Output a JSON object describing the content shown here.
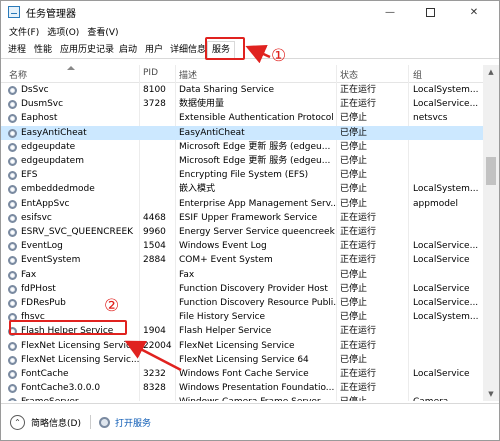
{
  "window": {
    "title": "任务管理器"
  },
  "window_controls": {
    "minimize": "—",
    "close": "✕"
  },
  "menu": [
    "文件(F)",
    "选项(O)",
    "查看(V)"
  ],
  "tabs": [
    {
      "label": "进程",
      "active": false
    },
    {
      "label": "性能",
      "active": false
    },
    {
      "label": "应用历史记录",
      "active": false
    },
    {
      "label": "启动",
      "active": false
    },
    {
      "label": "用户",
      "active": false
    },
    {
      "label": "详细信息",
      "active": false
    },
    {
      "label": "服务",
      "active": true
    }
  ],
  "columns": {
    "name": "名称",
    "pid": "PID",
    "desc": "描述",
    "status": "状态",
    "group": "组"
  },
  "rows": [
    {
      "name": "DsSvc",
      "pid": "8100",
      "desc": "Data Sharing Service",
      "status": "正在运行",
      "group": "LocalSystem..."
    },
    {
      "name": "DusmSvc",
      "pid": "3728",
      "desc": "数据使用量",
      "status": "正在运行",
      "group": "LocalService..."
    },
    {
      "name": "Eaphost",
      "pid": "",
      "desc": "Extensible Authentication Protocol",
      "status": "已停止",
      "group": "netsvcs"
    },
    {
      "name": "EasyAntiCheat",
      "pid": "",
      "desc": "EasyAntiCheat",
      "status": "已停止",
      "group": ""
    },
    {
      "name": "edgeupdate",
      "pid": "",
      "desc": "Microsoft Edge 更新 服务 (edgeu...",
      "status": "已停止",
      "group": ""
    },
    {
      "name": "edgeupdatem",
      "pid": "",
      "desc": "Microsoft Edge 更新 服务 (edgeu...",
      "status": "已停止",
      "group": ""
    },
    {
      "name": "EFS",
      "pid": "",
      "desc": "Encrypting File System (EFS)",
      "status": "已停止",
      "group": ""
    },
    {
      "name": "embeddedmode",
      "pid": "",
      "desc": "嵌入模式",
      "status": "已停止",
      "group": "LocalSystem..."
    },
    {
      "name": "EntAppSvc",
      "pid": "",
      "desc": "Enterprise App Management Serv...",
      "status": "已停止",
      "group": "appmodel"
    },
    {
      "name": "esifsvc",
      "pid": "4468",
      "desc": "ESIF Upper Framework Service",
      "status": "正在运行",
      "group": ""
    },
    {
      "name": "ESRV_SVC_QUEENCREEK",
      "pid": "9960",
      "desc": "Energy Server Service queencreek",
      "status": "正在运行",
      "group": ""
    },
    {
      "name": "EventLog",
      "pid": "1504",
      "desc": "Windows Event Log",
      "status": "正在运行",
      "group": "LocalService..."
    },
    {
      "name": "EventSystem",
      "pid": "2884",
      "desc": "COM+ Event System",
      "status": "正在运行",
      "group": "LocalService"
    },
    {
      "name": "Fax",
      "pid": "",
      "desc": "Fax",
      "status": "已停止",
      "group": ""
    },
    {
      "name": "fdPHost",
      "pid": "",
      "desc": "Function Discovery Provider Host",
      "status": "已停止",
      "group": "LocalService"
    },
    {
      "name": "FDResPub",
      "pid": "",
      "desc": "Function Discovery Resource Publi...",
      "status": "已停止",
      "group": "LocalService..."
    },
    {
      "name": "fhsvc",
      "pid": "",
      "desc": "File History Service",
      "status": "已停止",
      "group": "LocalSystem..."
    },
    {
      "name": "Flash Helper Service",
      "pid": "1904",
      "desc": "Flash Helper Service",
      "status": "正在运行",
      "group": ""
    },
    {
      "name": "FlexNet Licensing Service",
      "pid": "22004",
      "desc": "FlexNet Licensing Service",
      "status": "正在运行",
      "group": ""
    },
    {
      "name": "FlexNet Licensing Servic...",
      "pid": "",
      "desc": "FlexNet Licensing Service 64",
      "status": "已停止",
      "group": ""
    },
    {
      "name": "FontCache",
      "pid": "3232",
      "desc": "Windows Font Cache Service",
      "status": "正在运行",
      "group": "LocalService"
    },
    {
      "name": "FontCache3.0.0.0",
      "pid": "8328",
      "desc": "Windows Presentation Foundatio...",
      "status": "正在运行",
      "group": ""
    },
    {
      "name": "FrameServer",
      "pid": "",
      "desc": "Windows Camera Frame Server",
      "status": "已停止",
      "group": "Camera"
    }
  ],
  "footer": {
    "brief": "简略信息(D)",
    "open_services": "打开服务"
  },
  "annotations": {
    "one": "①",
    "two": "②",
    "color": "#e0221f"
  }
}
